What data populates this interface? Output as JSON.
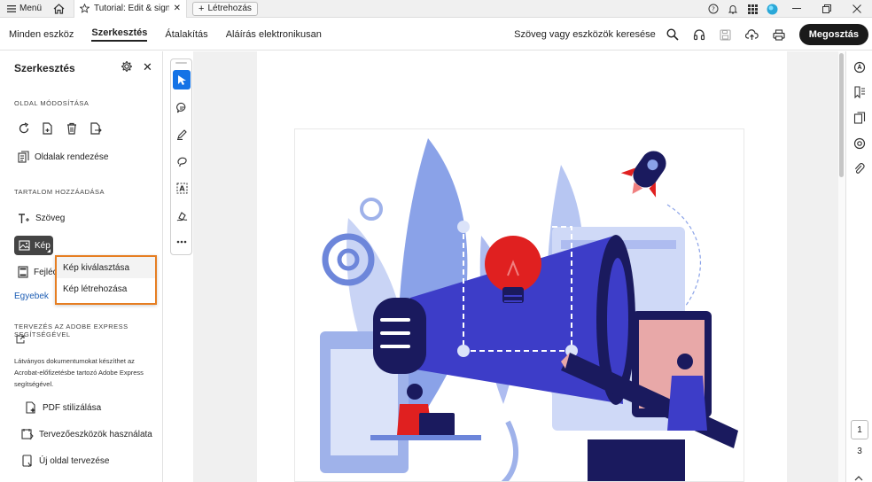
{
  "tabbar": {
    "menu_label": "Menü",
    "active_tab_title": "Tutorial: Edit & sign ...",
    "new_tab_label": "Létrehozás"
  },
  "toolbar": {
    "tabs": [
      {
        "label": "Minden eszköz"
      },
      {
        "label": "Szerkesztés"
      },
      {
        "label": "Átalakítás"
      },
      {
        "label": "Aláírás elektronikusan"
      }
    ],
    "search_label": "Szöveg vagy eszközök keresése",
    "share_label": "Megosztás"
  },
  "leftpanel": {
    "title": "Szerkesztés",
    "section_page": "OLDAL MÓDOSÍTÁSA",
    "reorder_label": "Oldalak rendezése",
    "section_content": "TARTALOM HOZZÁADÁSA",
    "text_label": "Szöveg",
    "image_label": "Kép",
    "header_label": "Fejléc",
    "more_label": "Egyebek",
    "section_express": "TERVEZÉS AZ ADOBE EXPRESS SEGÍTSÉGÉVEL",
    "express_desc": "Látványos dokumentumokat készíthet az Acrobat-előfizetésbe tartozó Adobe Express segítségével.",
    "express_items": [
      {
        "label": "PDF stilizálása"
      },
      {
        "label": "Tervezőeszközök használata"
      },
      {
        "label": "Új oldal tervezése"
      }
    ]
  },
  "dropdown": {
    "items": [
      {
        "label": "Kép kiválasztása"
      },
      {
        "label": "Kép létrehozása"
      }
    ]
  },
  "pagination": {
    "current": "1",
    "total": "3"
  },
  "colors": {
    "accent_blue": "#1473e6",
    "highlight_orange": "#e67e22",
    "illus_blue": "#3d3dc8",
    "illus_navy": "#1a1a5e",
    "illus_red": "#e02020"
  }
}
